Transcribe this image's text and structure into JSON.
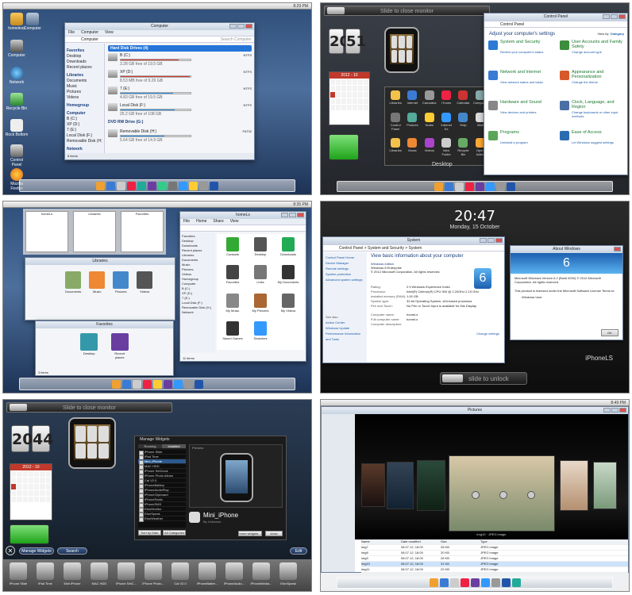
{
  "screens": {
    "p1": {
      "desktop_icons": [
        "homeless",
        "Computer",
        "Computer",
        "Network",
        "Recycle Bin",
        "Rock Bottom",
        "Control Panel",
        "Mozilla Firefox"
      ],
      "window_title": "Computer",
      "menu": [
        "File",
        "Computer",
        "View"
      ],
      "address": "Computer",
      "search_placeholder": "Search Computer",
      "sidebar": {
        "favorites_header": "Favorites",
        "favorites": [
          "Desktop",
          "Downloads",
          "Recent places"
        ],
        "libraries_header": "Libraries",
        "libraries": [
          "Documents",
          "Music",
          "Pictures",
          "Videos"
        ],
        "homegroup": "Homegroup",
        "computer_header": "Computer",
        "computer": [
          "B (C:)",
          "XP (D:)",
          "7 (E:)",
          "Local Disk (F:)",
          "Removable Disk (H:)"
        ],
        "network": "Network"
      },
      "section_hdd": "Hard Disk Drives (4)",
      "drives": [
        {
          "name": "B (C:)",
          "fs": "NTFS",
          "free": "3.28 GB free of 19.5 GB",
          "fill": 0.83,
          "warn": true
        },
        {
          "name": "XP (D:)",
          "fs": "NTFS",
          "free": "8.53 MB free of 9.29 GB",
          "fill": 0.99,
          "warn": true
        },
        {
          "name": "7 (E:)",
          "fs": "NTFS",
          "free": "4.83 GB free of 19.5 GB",
          "fill": 0.75,
          "warn": false
        },
        {
          "name": "Local Disk (F:)",
          "fs": "NTFS",
          "free": "25.2 GB free of 108 GB",
          "fill": 0.77,
          "warn": false
        }
      ],
      "section_dvd": "DVD RW Drive (G:)",
      "removable": {
        "name": "Removable Disk (H:)",
        "fs": "FAT32",
        "free": "5.64 GB free of 14.9 GB",
        "fill": 0.62
      },
      "status": "8 items",
      "clock": "8:29 PM"
    },
    "p2": {
      "slide_text": "Slide to close monitor",
      "clock_h": "20",
      "clock_m": "51",
      "calendar_header": "2012 - 10",
      "app_grid_label": "Desktop",
      "apps": [
        "Libraries",
        "Internet",
        "Calculator",
        "iTunes",
        "Calendar",
        "Computer",
        "Control Panel",
        "Pictures",
        "Notes",
        "Internet Ex",
        "Help",
        "Mail",
        "Libraries",
        "Music",
        "Videos",
        "New Folder",
        "Recycle Bin",
        "Open folder"
      ],
      "cp_title": "Control Panel",
      "cp_address": "Control Panel",
      "cp_heading": "Adjust your computer's settings",
      "cp_view_by": "View by:",
      "cp_view_value": "Category",
      "cp_items": [
        {
          "title": "System and Security",
          "sub": "Review your computer's status"
        },
        {
          "title": "User Accounts and Family Safety",
          "sub": "Change account type"
        },
        {
          "title": "Network and Internet",
          "sub": "View network status and tasks"
        },
        {
          "title": "Appearance and Personalization",
          "sub": "Change the theme"
        },
        {
          "title": "Hardware and Sound",
          "sub": "View devices and printers"
        },
        {
          "title": "Clock, Language, and Region",
          "sub": "Change keyboards or other input methods"
        },
        {
          "title": "Programs",
          "sub": "Uninstall a program"
        },
        {
          "title": "Ease of Access",
          "sub": "Let Windows suggest settings"
        }
      ]
    },
    "p3": {
      "clock": "8:35 PM",
      "win1_title": "homeLs",
      "win1_menu": [
        "File",
        "Home",
        "Share",
        "View"
      ],
      "win1_side": [
        "Favorites",
        "Desktop",
        "Downloads",
        "Recent places",
        "Libraries",
        "Documents",
        "Music",
        "Pictures",
        "Videos",
        "Homegroup",
        "Computer",
        "B (C:)",
        "XP (D:)",
        "7 (E:)",
        "Local Disk (F:)",
        "Removable Disk (H:)",
        "Network"
      ],
      "win1_files": [
        "Contacts",
        "Desktop",
        "Downloads",
        "Favorites",
        "Links",
        "My Documents",
        "My Music",
        "My Pictures",
        "My Videos",
        "Saved Games",
        "Searches"
      ],
      "win1_status": "11 items",
      "lib_title": "Libraries",
      "lib_items": [
        "Documents",
        "Music",
        "Pictures",
        "Videos"
      ],
      "fav_title": "Favorites",
      "fav_items": [
        "Desktop",
        "Recent places"
      ],
      "fav_status": "3 items",
      "thumbs": [
        "homeLs",
        "Libraries",
        "Favorites"
      ]
    },
    "p4": {
      "lock_time": "20:47",
      "lock_date": "Monday, 15 October",
      "sys_title": "System",
      "sys_address": "Control Panel > System and Security > System",
      "sys_heading": "View basic information about your computer",
      "sys_edition_label": "Windows edition",
      "sys_edition": "Windows 8 Enterprise",
      "sys_copyright": "© 2012 Microsoft Corporation. All rights reserved.",
      "sys_left": [
        "Control Panel Home",
        "Device Manager",
        "Remote settings",
        "System protection",
        "Advanced system settings"
      ],
      "sys_left_bottom": [
        "See also",
        "Action Center",
        "Windows Update",
        "Performance Information and Tools"
      ],
      "sys_rows": [
        [
          "Rating:",
          "2.9 Windows Experience Index"
        ],
        [
          "Processor:",
          "Intel(R) Celeron(R) CPU 900 @ 2.20GHz 2.19 GHz"
        ],
        [
          "Installed memory (RAM):",
          "1.00 GB"
        ],
        [
          "System type:",
          "32-bit Operating System, x64-based processor"
        ],
        [
          "Pen and Touch:",
          "No Pen or Touch Input is available for this Display"
        ]
      ],
      "sys_name_rows": [
        [
          "Computer name:",
          "homeLs"
        ],
        [
          "Full computer name:",
          "homeLs"
        ],
        [
          "Computer description:",
          ""
        ]
      ],
      "change_settings": "Change settings",
      "about_title": "About Windows",
      "about_text": "Microsoft Windows Version 6.2 (Build 9200) © 2012 Microsoft Corporation. All rights reserved.",
      "about_license": "This product is licensed under the Microsoft Software License Terms to:",
      "about_user": "Windows User",
      "about_ok": "OK",
      "device_name": "iPhoneLS",
      "slide_unlock": "slide to unlock"
    },
    "p5": {
      "slide_text": "Slide to close monitor",
      "clock_h": "20",
      "clock_m": "44",
      "calendar_header": "2012 - 10",
      "manage_title": "Manage Widgets",
      "tabs": [
        "Running",
        "Installed"
      ],
      "preview_label": "Preview",
      "widgets": [
        "iPhone Slide",
        "iPad Time",
        "Mini_iPhone",
        "MAC HDD",
        "iPhone SetClock",
        "iPhone Photo Album",
        "Cal V2.0",
        "iPhoneBattery",
        "iPhoneAudioPlay",
        "iPhoneClipboard",
        "iPhoneRadio",
        "iPhoneSMS",
        "EtonMonitor",
        "EtonSpeak",
        "EtonWeather"
      ],
      "preview_name": "Mini_iPhone",
      "preview_author": "By Unknown",
      "more_widgets": "more widgets...",
      "sort_label": "Sort by Date",
      "all_categories": "All Categories",
      "close_label": "close",
      "manage_btn": "Manage Widgets",
      "search_btn": "Search",
      "edit_btn": "Edit",
      "shelf": [
        "iPhone Slide",
        "iPad Time",
        "Mini iPhone",
        "MAC HDD",
        "iPhone SetC...",
        "iPhone Photo...",
        "Cal V2.0",
        "iPhoneBatter...",
        "iPhoneAudio...",
        "iPhoneMedia...",
        "EtonSpeak"
      ]
    },
    "p6": {
      "title": "Pictures",
      "cover_caption": "img10",
      "cover_type": "JPEG image",
      "columns": [
        "Name",
        "Date modified",
        "Size",
        "Type"
      ],
      "files": [
        [
          "img7",
          "08.07.12, 18:00",
          "28 KB",
          "JPEG image"
        ],
        [
          "img8",
          "08.07.12, 18:00",
          "20 KB",
          "JPEG image"
        ],
        [
          "img9",
          "08.07.12, 18:00",
          "26 KB",
          "JPEG image"
        ],
        [
          "img10",
          "08.07.12, 18:00",
          "31 KB",
          "JPEG image"
        ],
        [
          "img11",
          "08.07.12, 18:00",
          "22 KB",
          "JPEG image"
        ]
      ],
      "clock": "8:49 PM"
    }
  }
}
